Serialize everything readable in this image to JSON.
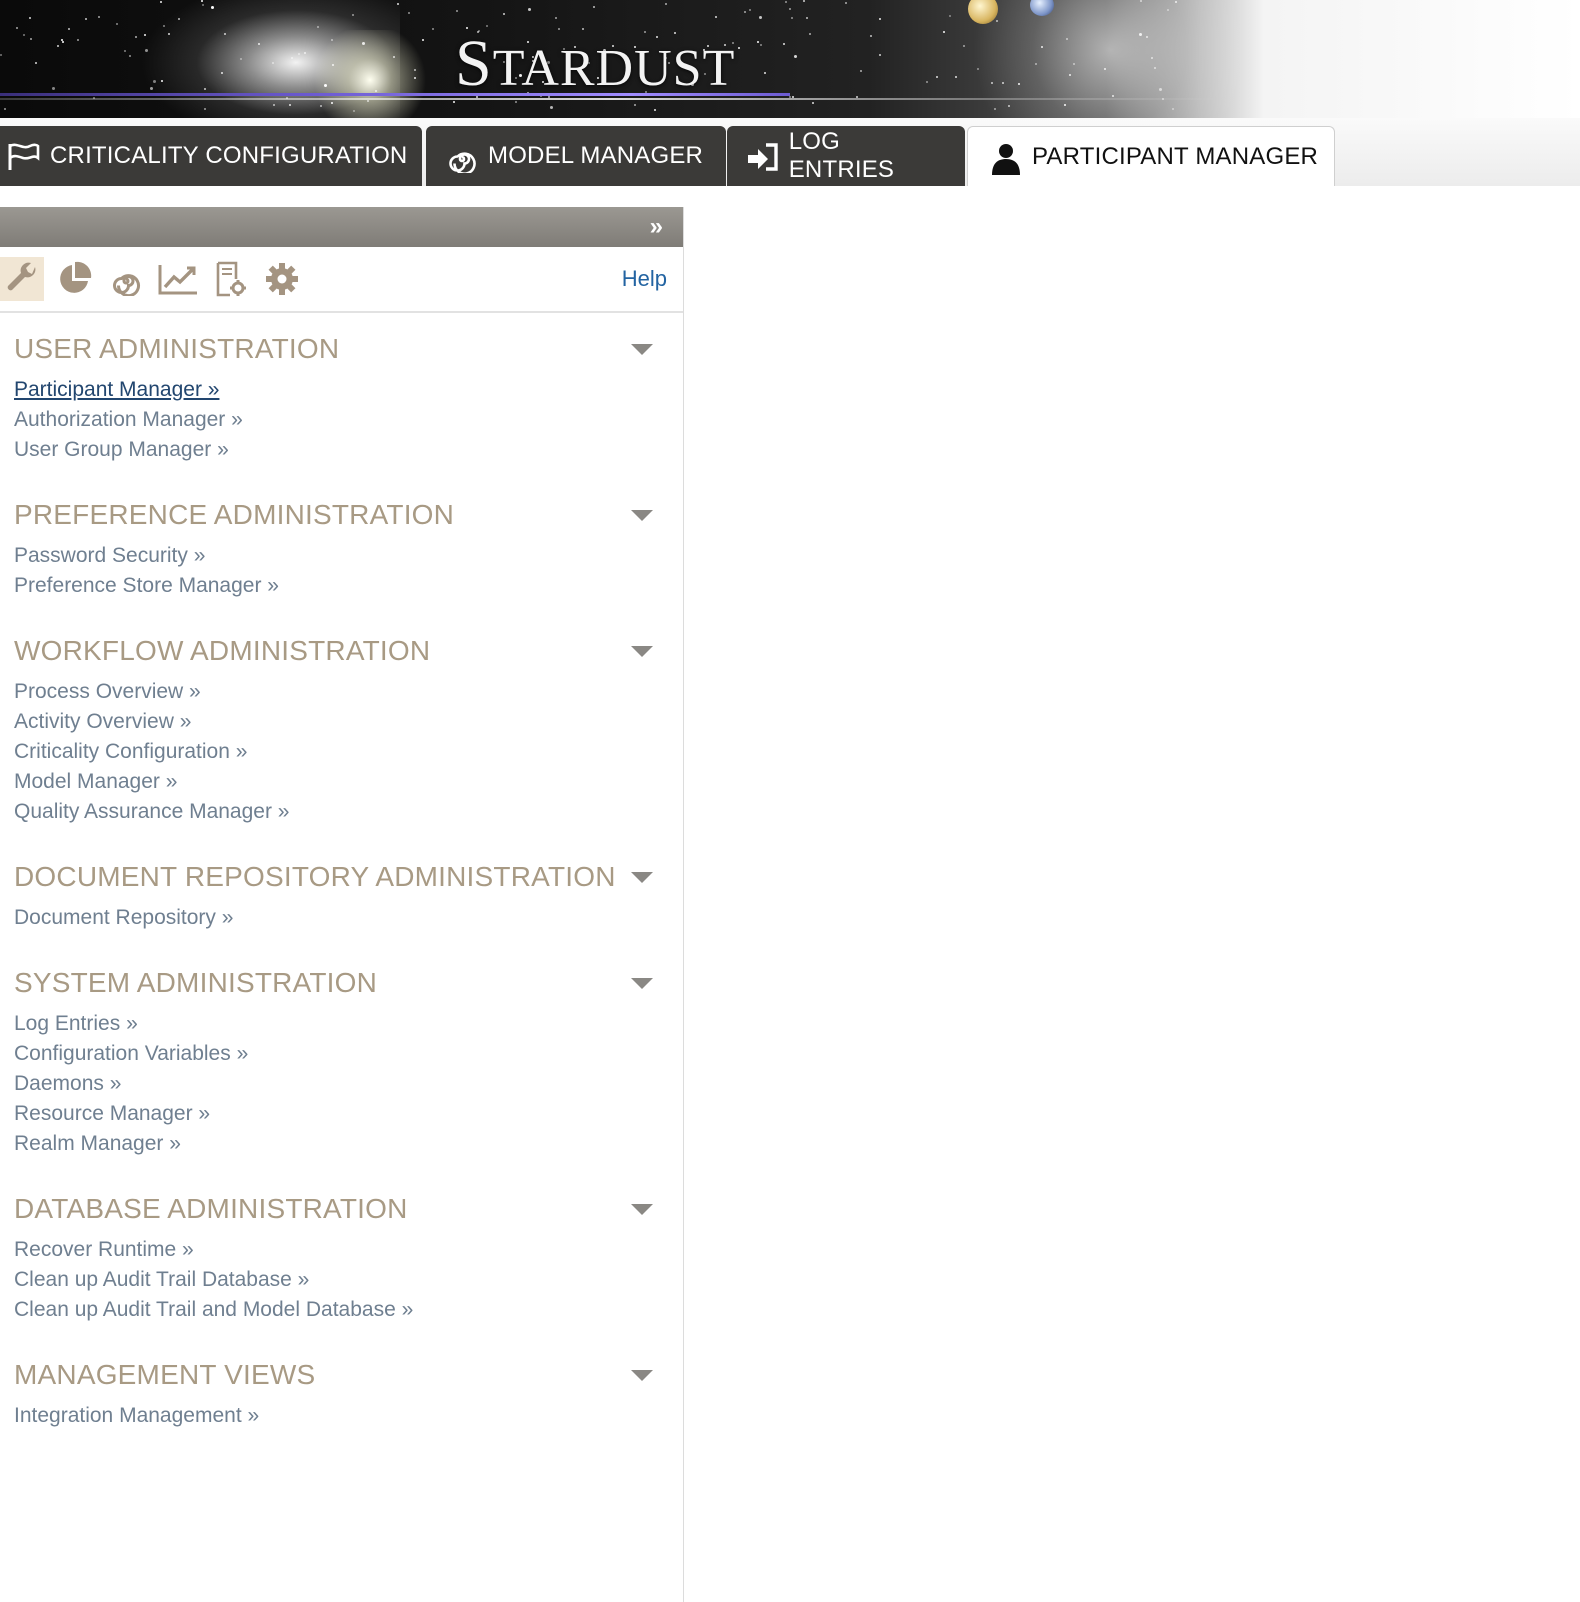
{
  "banner": {
    "logo_cap": "S",
    "logo_rest": "TARDUST"
  },
  "tabs": [
    {
      "label": "CRITICALITY CONFIGURATION",
      "icon": "flag-icon"
    },
    {
      "label": "MODEL MANAGER",
      "icon": "spiral-icon"
    },
    {
      "label": "LOG ENTRIES",
      "icon": "sign-in-icon"
    },
    {
      "label": "PARTICIPANT MANAGER",
      "icon": "user-icon",
      "active": true
    }
  ],
  "panel": {
    "collapse_label": "»",
    "toolbar": {
      "icons": [
        "wrench-icon",
        "pie-chart-icon",
        "spiral-icon",
        "line-chart-icon",
        "document-settings-icon",
        "gear-icon"
      ],
      "selected": "wrench-icon",
      "help_label": "Help"
    },
    "sections": [
      {
        "title": "USER ADMINISTRATION",
        "links": [
          "Participant Manager »",
          "Authorization Manager »",
          "User Group Manager »"
        ]
      },
      {
        "title": "PREFERENCE ADMINISTRATION",
        "links": [
          "Password Security »",
          "Preference Store Manager »"
        ]
      },
      {
        "title": "WORKFLOW ADMINISTRATION",
        "links": [
          "Process Overview »",
          "Activity Overview »",
          "Criticality Configuration »",
          "Model Manager »",
          "Quality Assurance Manager »"
        ]
      },
      {
        "title": "DOCUMENT REPOSITORY ADMINISTRATION",
        "links": [
          "Document Repository »"
        ]
      },
      {
        "title": "SYSTEM ADMINISTRATION",
        "links": [
          "Log Entries »",
          "Configuration Variables »",
          "Daemons »",
          "Resource Manager »",
          "Realm Manager »"
        ]
      },
      {
        "title": "DATABASE ADMINISTRATION",
        "links": [
          "Recover Runtime »",
          "Clean up Audit Trail Database »",
          "Clean up Audit Trail and Model Database »"
        ]
      },
      {
        "title": "MANAGEMENT VIEWS",
        "links": [
          "Integration Management »"
        ]
      }
    ]
  },
  "colors": {
    "tab_dark": "#3b3a38",
    "section_title": "#a89a84",
    "link": "#6f7f90",
    "link_current": "#22466f",
    "help": "#2364a2"
  }
}
